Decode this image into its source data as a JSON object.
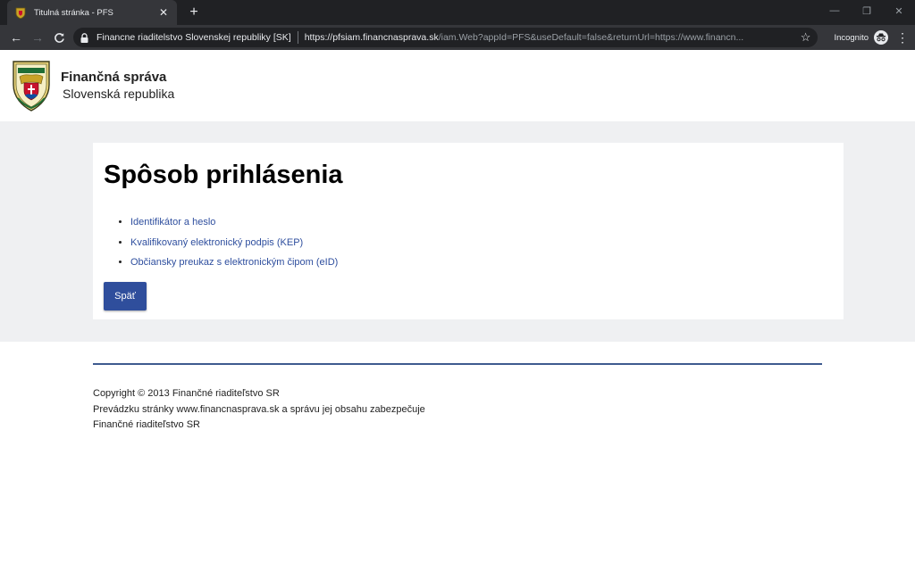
{
  "browser": {
    "tab_title": "Titulná stránka - PFS",
    "site_name": "Financne riaditelstvo Slovenskej republiky [SK]",
    "url_host": "https://pfsiam.financnasprava.sk",
    "url_rest": "/iam.Web?appId=PFS&useDefault=false&returnUrl=https://www.financn...",
    "incognito_label": "Incognito"
  },
  "header": {
    "brand_name": "Finančná správa",
    "brand_sub": "Slovenská republika"
  },
  "login": {
    "title": "Spôsob prihlásenia",
    "options": [
      "Identifikátor a heslo",
      "Kvalifikovaný elektronický podpis (KEP)",
      "Občiansky preukaz s elektronickým čipom (eID)"
    ],
    "back_label": "Späť"
  },
  "footer": {
    "line1": "Copyright © 2013 Finančné riaditeľstvo SR",
    "line2": "Prevádzku stránky www.financnasprava.sk a správu jej obsahu zabezpečuje",
    "line3": "Finančné riaditeľstvo SR"
  },
  "colors": {
    "accent": "#2f4e9c",
    "link": "#2e4e9e",
    "band": "#eff0f2",
    "rule": "#3e5b8f"
  }
}
